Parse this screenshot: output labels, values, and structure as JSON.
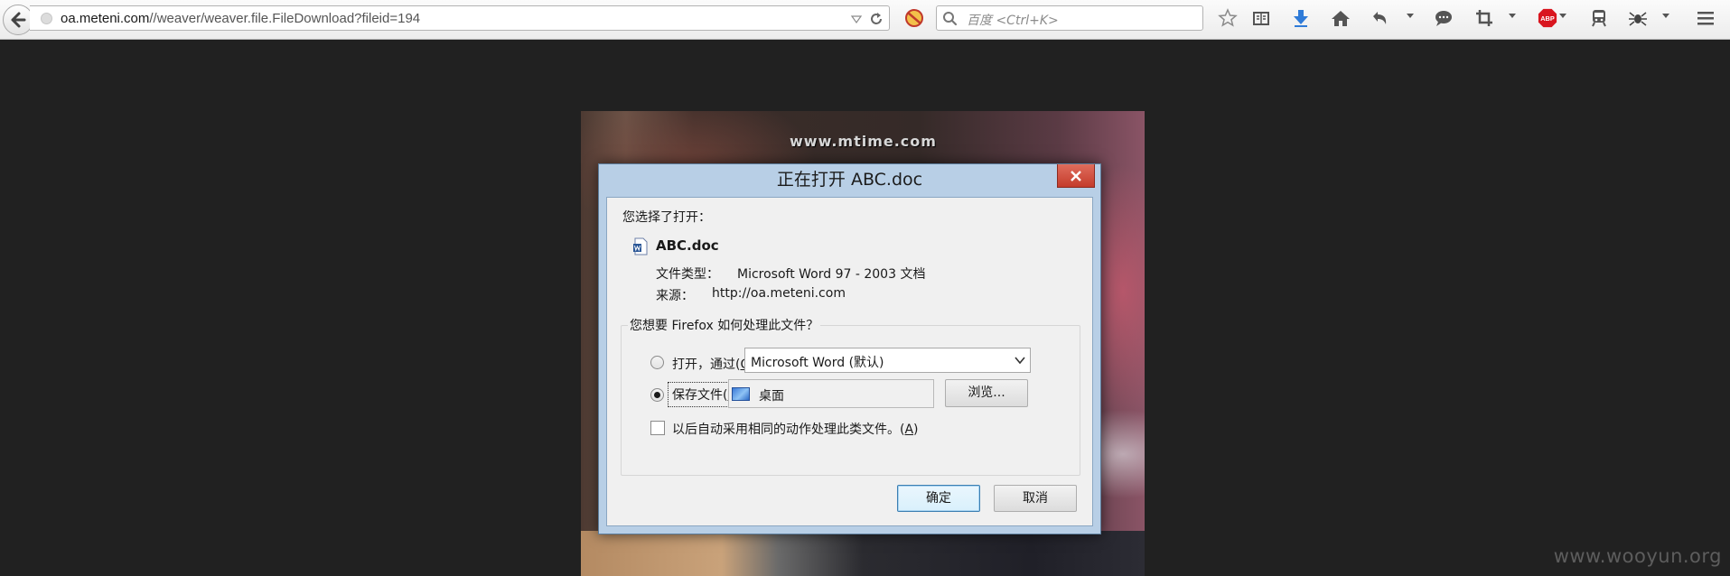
{
  "browser": {
    "url_host": "oa.meteni.com",
    "url_path": "//weaver/weaver.file.FileDownload?fileid=194",
    "search_placeholder": "百度 <Ctrl+K>",
    "abp_label": "ABP"
  },
  "toolbar_icons": [
    "back-arrow-icon",
    "favicon-globe-icon",
    "url-dropdown-icon",
    "reload-icon",
    "noscript-icon",
    "search-icon",
    "bookmark-star-icon",
    "reading-list-icon",
    "downloads-icon",
    "home-icon",
    "undo-icon",
    "menu-caret-icon",
    "chat-icon",
    "crop-icon",
    "menu-caret-icon",
    "adblock-plus-icon",
    "train-icon",
    "spider-icon",
    "menu-caret-icon",
    "hamburger-menu-icon"
  ],
  "page": {
    "photo_watermark": "www.mtime.com",
    "site_watermark": "www.wooyun.org"
  },
  "dialog": {
    "title": "正在打开 ABC.doc",
    "chose_label": "您选择了打开：",
    "file_name": "ABC.doc",
    "file_type_label": "文件类型：",
    "file_type_value": "Microsoft Word 97 - 2003 文档",
    "source_label": "来源：",
    "source_value": "http://oa.meteni.com",
    "question": "您想要 Firefox 如何处理此文件？",
    "open_with_prefix": "打开，通过(",
    "open_with_key": "O",
    "open_with_suffix": ")",
    "open_with_selected": "Microsoft Word (默认)",
    "save_prefix": "保存文件(",
    "save_key": "S",
    "save_suffix": ")",
    "save_folder": "桌面",
    "browse_label": "浏览...",
    "auto_prefix": "以后自动采用相同的动作处理此类文件。(",
    "auto_key": "A",
    "auto_suffix": ")",
    "ok_label": "确定",
    "cancel_label": "取消",
    "selected_action": "save",
    "auto_checked": false
  }
}
